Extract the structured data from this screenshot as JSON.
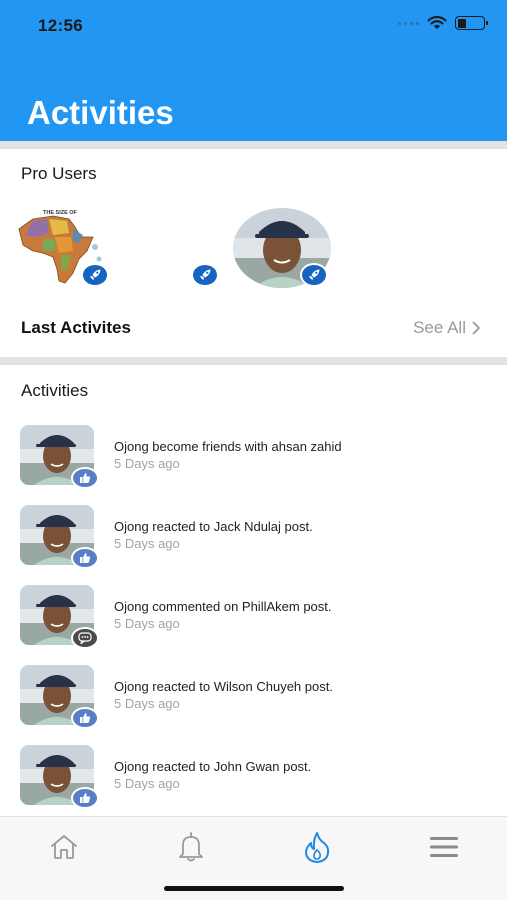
{
  "status_bar": {
    "time": "12:56"
  },
  "header": {
    "title": "Activities"
  },
  "pro_users": {
    "title": "Pro Users"
  },
  "last_activities": {
    "label": "Last Activites",
    "see_all": "See All"
  },
  "activities": {
    "title": "Activities",
    "items": [
      {
        "text": "Ojong become friends with ahsan zahid",
        "time": "5 Days ago",
        "badge": "like-icon"
      },
      {
        "text": "Ojong reacted to Jack Ndulaj post.",
        "time": "5 Days ago",
        "badge": "like-icon"
      },
      {
        "text": "Ojong commented on PhillAkem post.",
        "time": "5 Days ago",
        "badge": "comment-icon"
      },
      {
        "text": "Ojong reacted to Wilson Chuyeh post.",
        "time": "5 Days ago",
        "badge": "like-icon"
      },
      {
        "text": "Ojong reacted to John Gwan post.",
        "time": "5 Days ago",
        "badge": "like-icon"
      }
    ]
  },
  "tabbar": {
    "tabs": [
      {
        "icon": "home-icon",
        "active": false
      },
      {
        "icon": "bell-icon",
        "active": false
      },
      {
        "icon": "flame-icon",
        "active": true
      },
      {
        "icon": "menu-icon",
        "active": false
      }
    ]
  },
  "colors": {
    "header": "#2196f3",
    "accent": "#1e88e5",
    "badge": "#1565c0",
    "muted": "#a3a3a3"
  }
}
